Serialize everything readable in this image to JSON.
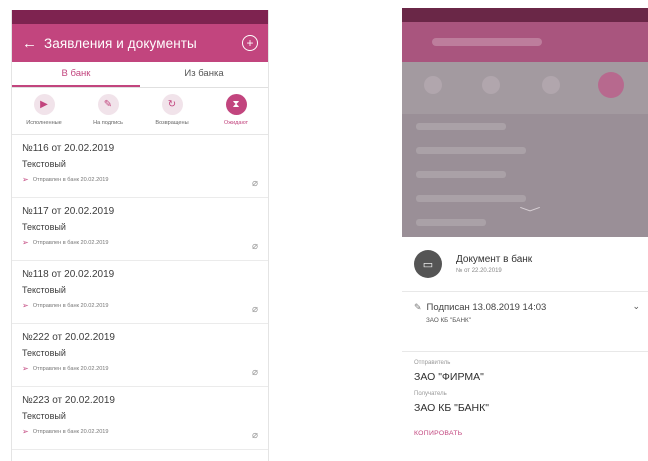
{
  "left": {
    "appbar": {
      "back_icon": "arrow-left-icon",
      "title": "Заявления и документы",
      "add_icon": "plus-circle-icon"
    },
    "tabs": [
      {
        "label": "В банк",
        "active": true
      },
      {
        "label": "Из банка",
        "active": false
      }
    ],
    "filters": [
      {
        "label": "Исполненные",
        "icon": "document-icon",
        "glyph": "▶"
      },
      {
        "label": "На подпись",
        "icon": "signature-icon",
        "glyph": "✎"
      },
      {
        "label": "Возвращены",
        "icon": "refresh-icon",
        "glyph": "↻"
      },
      {
        "label": "Ожидают",
        "icon": "hourglass-icon",
        "glyph": "⧗"
      }
    ],
    "documents": [
      {
        "number": "№116 от 20.02.2019",
        "type": "Текстовый",
        "status": "Отправлен в банк 20.02.2019"
      },
      {
        "number": "№117 от 20.02.2019",
        "type": "Текстовый",
        "status": "Отправлен в банк 20.02.2019"
      },
      {
        "number": "№118 от 20.02.2019",
        "type": "Текстовый",
        "status": "Отправлен в банк 20.02.2019"
      },
      {
        "number": "№222 от 20.02.2019",
        "type": "Текстовый",
        "status": "Отправлен в банк 20.02.2019"
      },
      {
        "number": "№223 от 20.02.2019",
        "type": "Текстовый",
        "status": "Отправлен в банк 20.02.2019"
      }
    ],
    "colors": {
      "accent": "#c2457e",
      "status_bar": "#7e2350"
    }
  },
  "right": {
    "sheet": {
      "title": "Документ в банк",
      "subtitle": "№ от 22.20.2019",
      "signed_line": "Подписан  13.08.2019 14:03",
      "signed_by": "ЗАО КБ \"БАНК\"",
      "sender_label": "Отправитель",
      "sender_value": "ЗАО \"ФИРМА\"",
      "recipient_label": "Получатель",
      "recipient_value": "ЗАО КБ \"БАНК\"",
      "copy_button": "КОПИРОВАТЬ"
    }
  }
}
